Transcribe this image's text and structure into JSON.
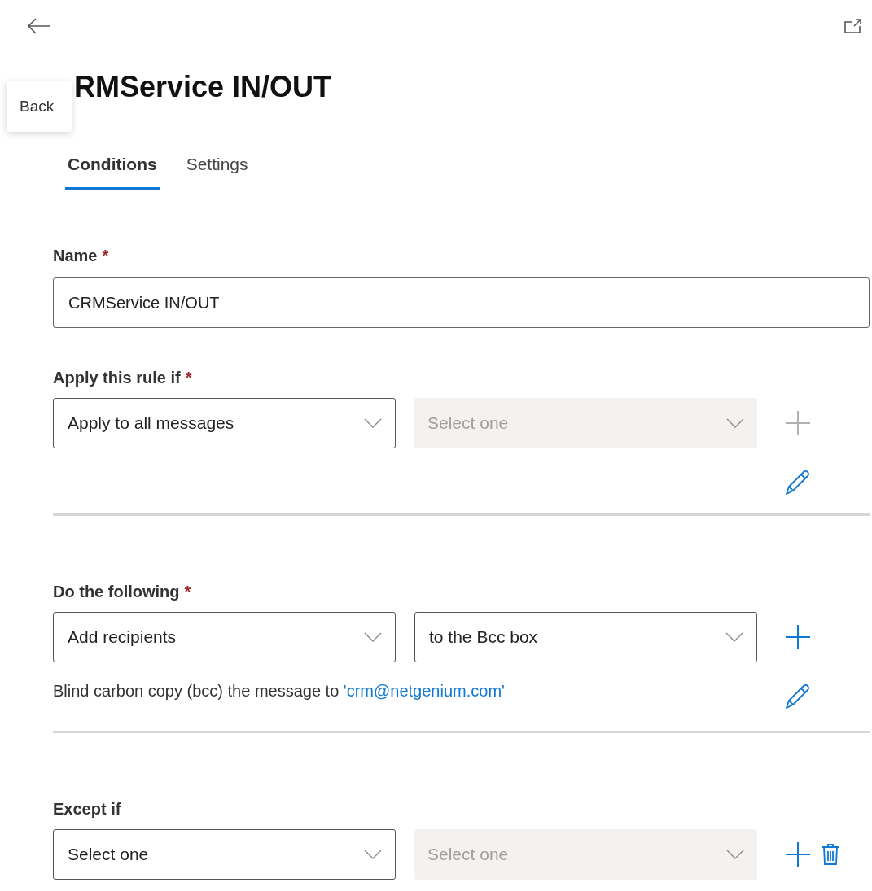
{
  "back_tooltip": "Back",
  "title": "RMService IN/OUT",
  "tabs": [
    {
      "label": "Conditions",
      "selected": true
    },
    {
      "label": "Settings",
      "selected": false
    }
  ],
  "name_field": {
    "label": "Name",
    "required_mark": "*",
    "value": "CRMService IN/OUT"
  },
  "sections": [
    {
      "label": "Apply this rule if",
      "required_mark": "*",
      "selects": [
        {
          "value": "Apply to all messages",
          "disabled": false,
          "placeholder": false
        },
        {
          "value": "Select one",
          "disabled": true,
          "placeholder": true
        }
      ],
      "add_disabled": true,
      "edit": true
    },
    {
      "label": "Do the following",
      "required_mark": "*",
      "selects": [
        {
          "value": "Add recipients",
          "disabled": false,
          "placeholder": false
        },
        {
          "value": "to the Bcc box",
          "disabled": false,
          "placeholder": false
        }
      ],
      "add_disabled": false,
      "description": {
        "text": "Blind carbon copy (bcc) the message to",
        "link": "'crm@netgenium.com'"
      },
      "edit": true
    },
    {
      "label": "Except if",
      "selects": [
        {
          "value": "Select one",
          "disabled": false,
          "placeholder": false
        },
        {
          "value": "Select one",
          "disabled": true,
          "placeholder": true
        }
      ],
      "add_disabled": false,
      "delete": true
    }
  ]
}
